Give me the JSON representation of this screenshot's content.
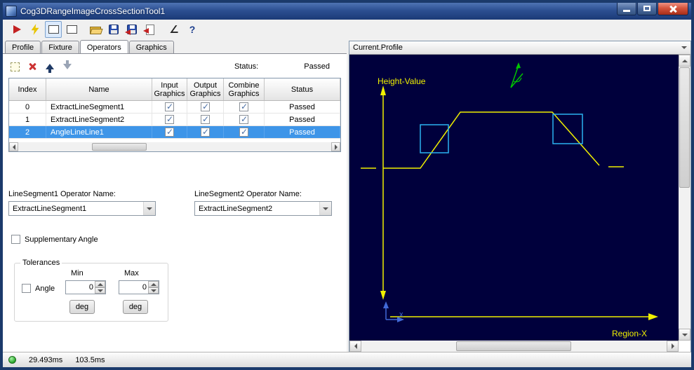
{
  "window": {
    "title": "Cog3DRangeImageCrossSectionTool1"
  },
  "toolbar": {
    "items": [
      {
        "name": "run-icon"
      },
      {
        "name": "electric-edit-icon"
      },
      {
        "name": "tool-display-toggle-icon"
      },
      {
        "name": "floating-window-icon"
      },
      {
        "name": "open-file-icon"
      },
      {
        "name": "save-icon"
      },
      {
        "name": "save-results-icon"
      },
      {
        "name": "import-icon"
      },
      {
        "name": "angle-tool-icon",
        "glyph": "∠"
      },
      {
        "name": "help-icon",
        "glyph": "?"
      }
    ]
  },
  "tabs": [
    {
      "label": "Profile",
      "active": false
    },
    {
      "label": "Fixture",
      "active": false
    },
    {
      "label": "Operators",
      "active": true
    },
    {
      "label": "Graphics",
      "active": false
    }
  ],
  "ops": {
    "status_label": "Status:",
    "status_value": "Passed",
    "table": {
      "columns": [
        {
          "line1": "Index",
          "line2": ""
        },
        {
          "line1": "Name",
          "line2": ""
        },
        {
          "line1": "Input",
          "line2": "Graphics"
        },
        {
          "line1": "Output",
          "line2": "Graphics"
        },
        {
          "line1": "Combine",
          "line2": "Graphics"
        },
        {
          "line1": "Status",
          "line2": ""
        }
      ],
      "rows": [
        {
          "index": "0",
          "name": "ExtractLineSegment1",
          "input": true,
          "output": true,
          "combine": true,
          "status": "Passed",
          "selected": false
        },
        {
          "index": "1",
          "name": "ExtractLineSegment2",
          "input": true,
          "output": true,
          "combine": true,
          "status": "Passed",
          "selected": false
        },
        {
          "index": "2",
          "name": "AngleLineLine1",
          "input": true,
          "output": true,
          "combine": true,
          "status": "Passed",
          "selected": true
        }
      ]
    },
    "combo1_label": "LineSegment1 Operator Name:",
    "combo1_value": "ExtractLineSegment1",
    "combo2_label": "LineSegment2 Operator Name:",
    "combo2_value": "ExtractLineSegment2",
    "supplementary_label": "Supplementary Angle",
    "supplementary_checked": false,
    "tolerances": {
      "title": "Tolerances",
      "angle_label": "Angle",
      "angle_checked": false,
      "min_label": "Min",
      "max_label": "Max",
      "min_value": "0",
      "max_value": "0",
      "deg_label": "deg"
    }
  },
  "graphics": {
    "selector_value": "Current.Profile",
    "height_label": "Height-Value",
    "region_label": "Region-X",
    "x_marker": "x",
    "colors": {
      "canvas_bg": "#00003c",
      "profile": "#f0f000",
      "marker_box": "#2bb3f0",
      "angle_indicator": "#00c400",
      "mini_axis": "#4169d8"
    }
  },
  "statusbar": {
    "time1": "29.493ms",
    "time2": "103.5ms"
  }
}
